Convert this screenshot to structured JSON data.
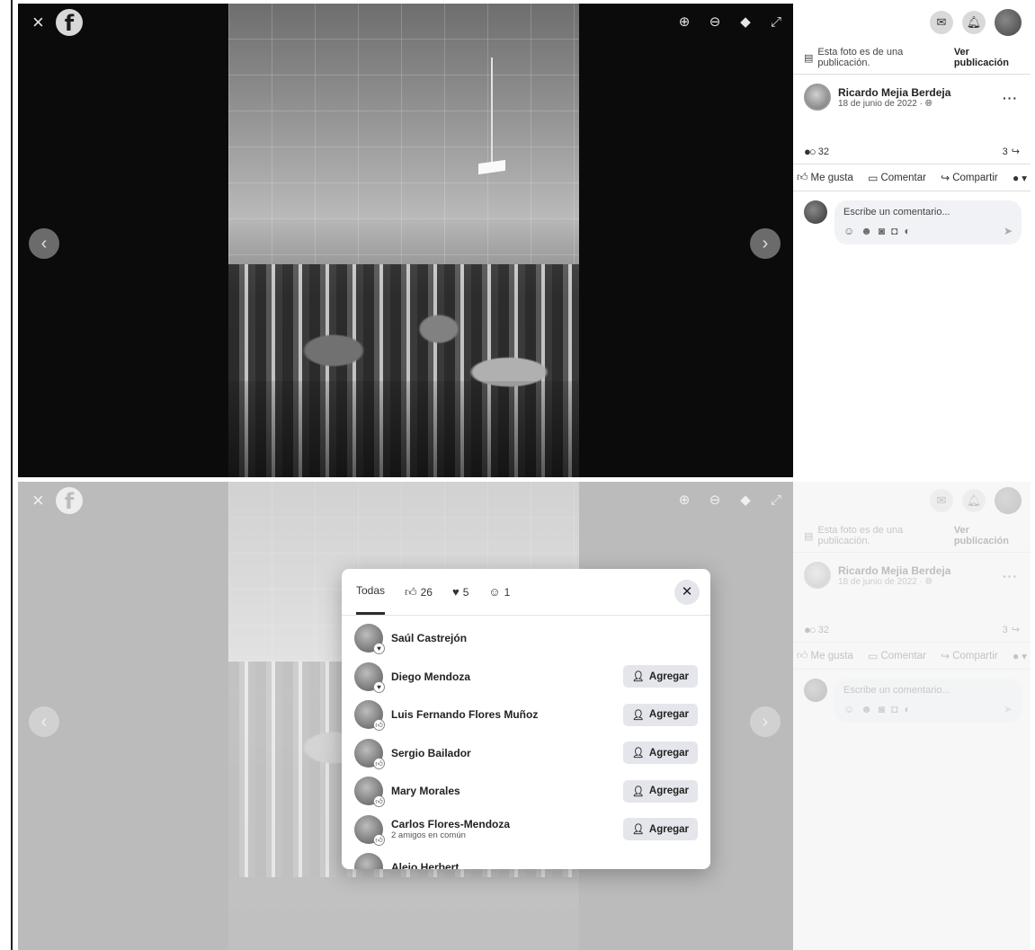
{
  "viewer": {
    "close_icon": "×",
    "fb_letter": "f",
    "tools": [
      {
        "name": "zoom-in-icon",
        "glyph": "⊕"
      },
      {
        "name": "zoom-out-icon",
        "glyph": "⊖"
      },
      {
        "name": "tag-icon",
        "glyph": "◆"
      },
      {
        "name": "fullscreen-icon",
        "glyph": "⤢"
      }
    ],
    "prev_glyph": "‹",
    "next_glyph": "›"
  },
  "sidebar": {
    "from_post_text": "Esta foto es de una publicación.",
    "see_post": "Ver publicación",
    "author_name": "Ricardo Mejia Berdeja",
    "post_date": "18 de junio de 2022 · ",
    "more_glyph": "···",
    "reaction_count": "32",
    "share_count": "3",
    "actions": {
      "like": "Me gusta",
      "comment": "Comentar",
      "share": "Compartir"
    },
    "comment_placeholder": "Escribe un comentario..."
  },
  "reactions_modal": {
    "tabs": [
      {
        "label": "Todas",
        "icon": ""
      },
      {
        "label": "26",
        "icon": "like-icon"
      },
      {
        "label": "5",
        "icon": "love-icon"
      },
      {
        "label": "1",
        "icon": "care-icon"
      }
    ],
    "add_label": "Agregar",
    "people": [
      {
        "name": "Saúl Castrejón",
        "sub": "",
        "add": false
      },
      {
        "name": "Diego Mendoza",
        "sub": "",
        "add": true
      },
      {
        "name": "Luis Fernando Flores Muñoz",
        "sub": "",
        "add": true
      },
      {
        "name": "Sergio Bailador",
        "sub": "",
        "add": true
      },
      {
        "name": "Mary Morales",
        "sub": "",
        "add": true
      },
      {
        "name": "Carlos Flores-Mendoza",
        "sub": "2 amigos en común",
        "add": true
      },
      {
        "name": "Alejo Herbert",
        "sub": "",
        "add": false
      }
    ]
  }
}
